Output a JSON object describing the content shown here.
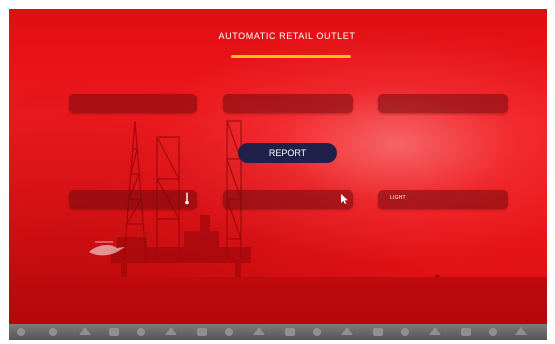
{
  "header": {
    "title": "AUTOMATIC RETAIL OUTLET"
  },
  "main": {
    "report_label": "REPORT",
    "top_fields": [
      "",
      "",
      ""
    ],
    "bottom_fields": [
      {
        "label": "",
        "icon": "thermometer-icon"
      },
      {
        "label": "",
        "icon": "cursor-icon"
      },
      {
        "label": "LIGHT",
        "icon": ""
      }
    ]
  },
  "colors": {
    "background": "#e8111a",
    "title_underline": "#f6c31d",
    "report_button": "#20204a"
  }
}
